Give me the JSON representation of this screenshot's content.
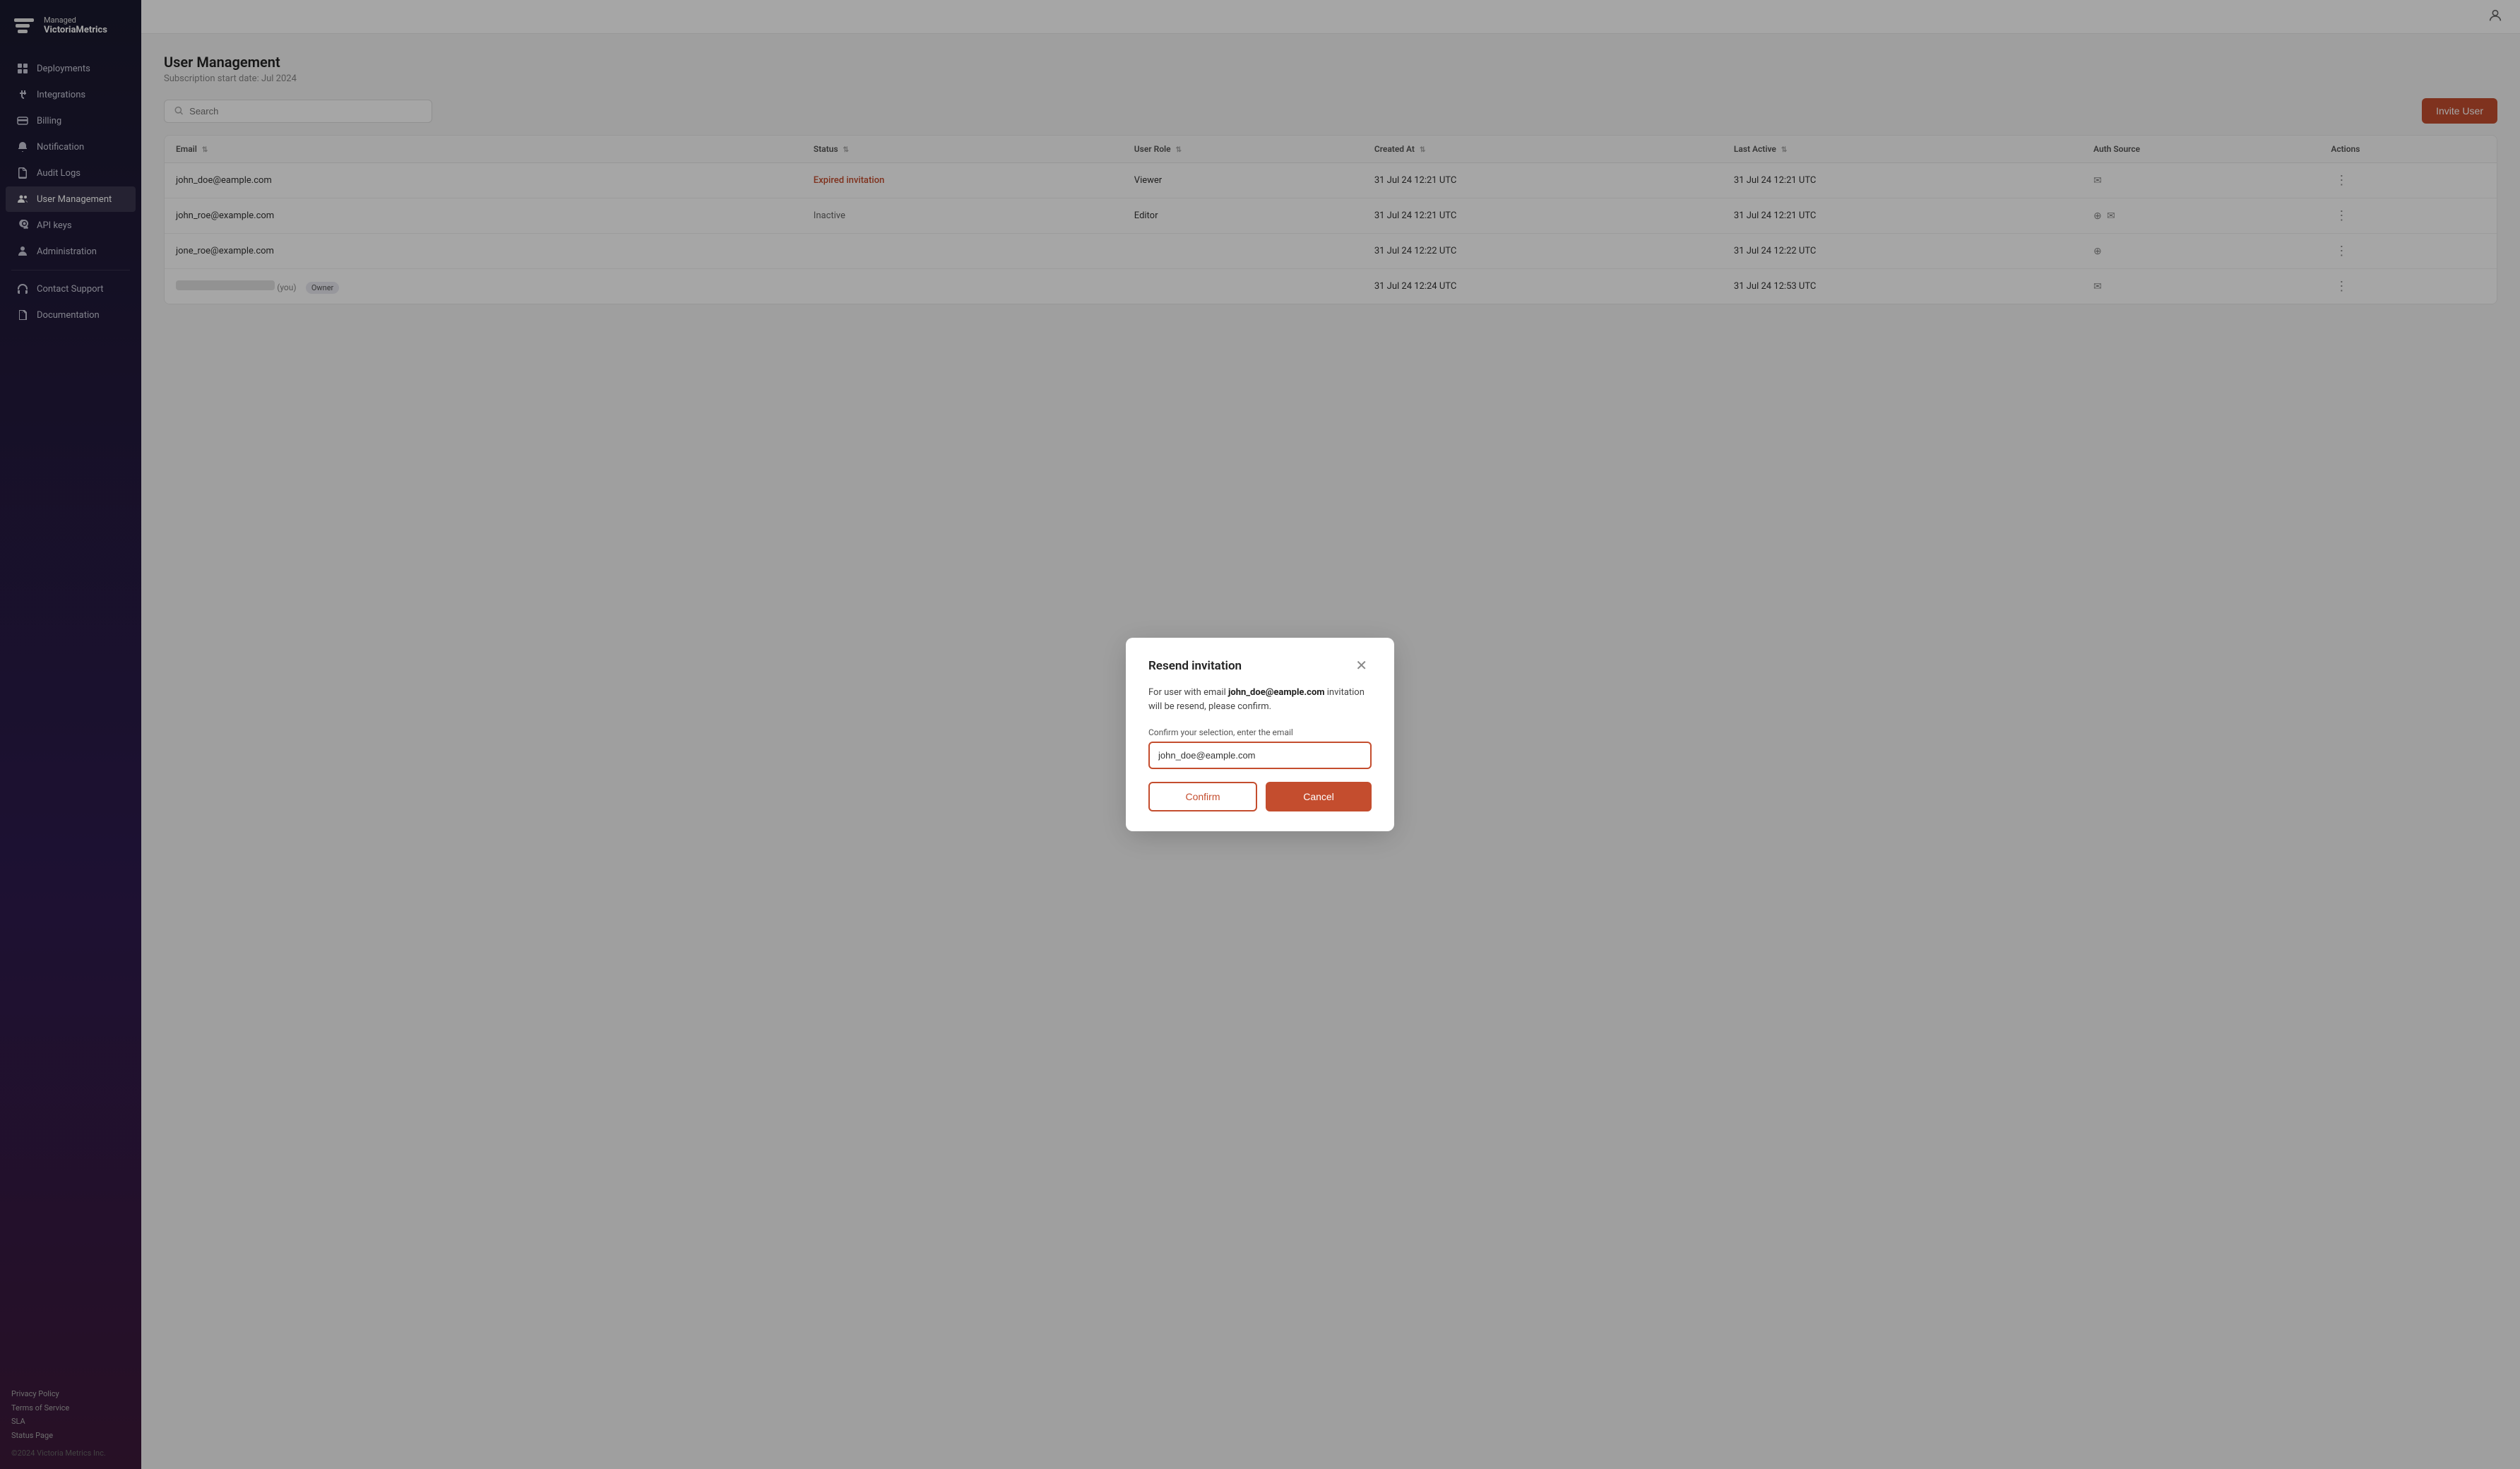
{
  "sidebar": {
    "logo": {
      "brand": "Managed",
      "name": "VictoriaMetrics"
    },
    "nav_items": [
      {
        "id": "deployments",
        "label": "Deployments",
        "icon": "grid-icon"
      },
      {
        "id": "integrations",
        "label": "Integrations",
        "icon": "plug-icon"
      },
      {
        "id": "billing",
        "label": "Billing",
        "icon": "credit-card-icon"
      },
      {
        "id": "notification",
        "label": "Notification",
        "icon": "bell-icon"
      },
      {
        "id": "audit-logs",
        "label": "Audit Logs",
        "icon": "file-icon"
      },
      {
        "id": "user-management",
        "label": "User Management",
        "icon": "users-icon",
        "active": true
      },
      {
        "id": "api-keys",
        "label": "API keys",
        "icon": "key-icon"
      },
      {
        "id": "administration",
        "label": "Administration",
        "icon": "person-icon"
      }
    ],
    "support_items": [
      {
        "id": "contact-support",
        "label": "Contact Support",
        "icon": "headset-icon"
      },
      {
        "id": "documentation",
        "label": "Documentation",
        "icon": "doc-icon"
      }
    ],
    "footer_links": [
      {
        "id": "privacy",
        "label": "Privacy Policy"
      },
      {
        "id": "terms",
        "label": "Terms of Service"
      },
      {
        "id": "sla",
        "label": "SLA"
      },
      {
        "id": "status",
        "label": "Status Page"
      }
    ],
    "copyright": "©2024 Victoria Metrics Inc."
  },
  "topbar": {
    "search_placeholder": ""
  },
  "page": {
    "title": "User Management",
    "subtitle": "Subscription start date: Jul 2024",
    "search_placeholder": "Search",
    "invite_button": "Invite User"
  },
  "table": {
    "columns": [
      {
        "id": "email",
        "label": "Email"
      },
      {
        "id": "status",
        "label": "Status"
      },
      {
        "id": "role",
        "label": "User Role"
      },
      {
        "id": "created_at",
        "label": "Created At"
      },
      {
        "id": "last_active",
        "label": "Last Active"
      },
      {
        "id": "auth_source",
        "label": "Auth Source"
      },
      {
        "id": "actions",
        "label": "Actions"
      }
    ],
    "rows": [
      {
        "email": "john_doe@eample.com",
        "status": "Expired invitation",
        "status_type": "expired",
        "role": "Viewer",
        "created_at": "31 Jul 24 12:21 UTC",
        "last_active": "31 Jul 24 12:21 UTC",
        "auth": [
          "mail"
        ],
        "you": false,
        "owner": false
      },
      {
        "email": "john_roe@example.com",
        "status": "Inactive",
        "status_type": "inactive",
        "role": "Editor",
        "created_at": "31 Jul 24 12:21 UTC",
        "last_active": "31 Jul 24 12:21 UTC",
        "auth": [
          "google",
          "mail"
        ],
        "you": false,
        "owner": false
      },
      {
        "email": "jone_roe@example.com",
        "status": "",
        "status_type": "active",
        "role": "",
        "created_at": "...22 UTC",
        "last_active": "31 Jul 24 12:22 UTC",
        "auth": [
          "google"
        ],
        "you": false,
        "owner": false
      },
      {
        "email": "",
        "status": "",
        "status_type": "owner",
        "role": "Owner",
        "created_at": "...24 UTC",
        "last_active": "31 Jul 24 12:53 UTC",
        "auth": [
          "mail"
        ],
        "you": true,
        "owner": true
      }
    ]
  },
  "modal": {
    "title": "Resend invitation",
    "body_text": "For user with email ",
    "email_highlight": "john_doe@eample.com",
    "body_suffix": " invitation will be resend, please confirm.",
    "label": "Confirm your selection, enter the email",
    "input_value": "john_doe@eample.com",
    "confirm_button": "Confirm",
    "cancel_button": "Cancel"
  }
}
